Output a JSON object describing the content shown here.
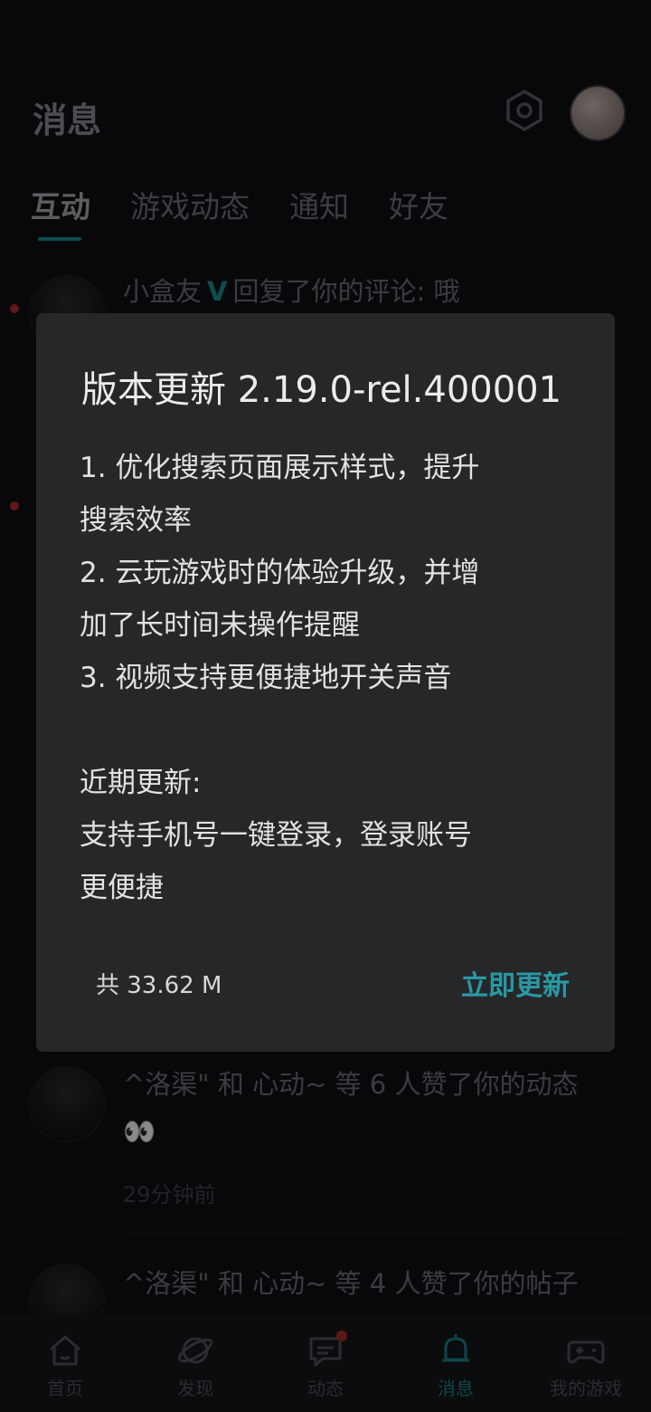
{
  "header": {
    "title": "消息"
  },
  "tabs": [
    {
      "label": "互动"
    },
    {
      "label": "游戏动态"
    },
    {
      "label": "通知"
    },
    {
      "label": "好友"
    }
  ],
  "messages": [
    {
      "user": "小盒友",
      "verified_mark": "V",
      "text": "回复了你的评论: 哦"
    },
    {
      "text": "^洛渠\" 和 心动~ 等 6 人赞了你的动态",
      "emoji": "👀",
      "time": "29分钟前"
    },
    {
      "text": "^洛渠\" 和 心动~ 等 4 人赞了你的帖子"
    }
  ],
  "dialog": {
    "title": "版本更新 2.19.0-rel.400001",
    "lines": [
      "1. 优化搜索页面展示样式，提升",
      "搜索效率",
      "2. 云玩游戏时的体验升级，并增",
      "加了长时间未操作提醒",
      "3. 视频支持更便捷地开关声音"
    ],
    "recent_title": "近期更新:",
    "recent_lines": [
      "支持手机号一键登录，登录账号",
      "更便捷"
    ],
    "size": "共 33.62 M",
    "update_button": "立即更新"
  },
  "nav": [
    {
      "label": "首页",
      "icon": "home-icon"
    },
    {
      "label": "发现",
      "icon": "planet-icon"
    },
    {
      "label": "动态",
      "icon": "chat-icon"
    },
    {
      "label": "消息",
      "icon": "bell-icon"
    },
    {
      "label": "我的游戏",
      "icon": "gamepad-icon"
    }
  ],
  "colors": {
    "accent": "#2a98a3",
    "badge": "#b02a2a",
    "background": "#0f1014"
  }
}
